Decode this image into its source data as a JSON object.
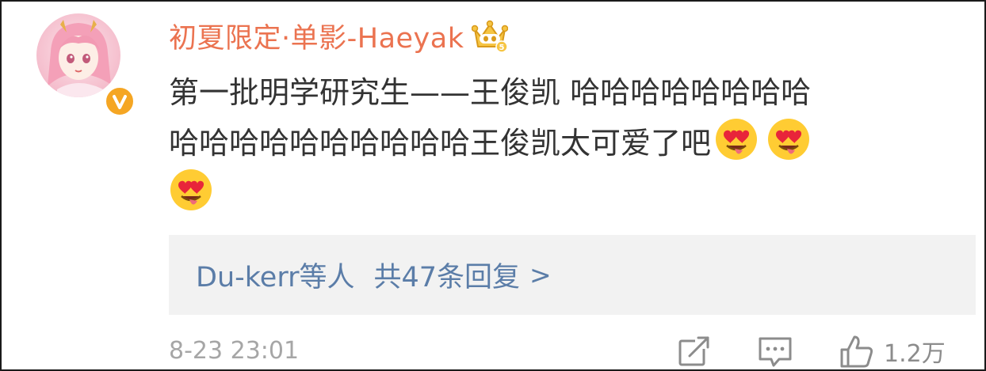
{
  "comment": {
    "username": "初夏限定·单影-Haeyak",
    "text_line1": "第一批明学研究生——王俊凯 哈哈哈哈哈哈哈哈",
    "text_line2": "哈哈哈哈哈哈哈哈哈哈王俊凯太可爱了吧",
    "emoji": "heart-eyes-tongue-emoji",
    "membership_badge": "crown-icon",
    "verified_badge": "verified-v-icon",
    "colors": {
      "username": "#eb7350",
      "link": "#5b7da8",
      "meta": "#a6a6a6",
      "badge": "#f5a623"
    }
  },
  "replies": {
    "users": "Du-kerr等人",
    "count_label": "共47条回复",
    "chevron": ">"
  },
  "footer": {
    "timestamp": "8-23 23:01",
    "like_count": "1.2万"
  }
}
